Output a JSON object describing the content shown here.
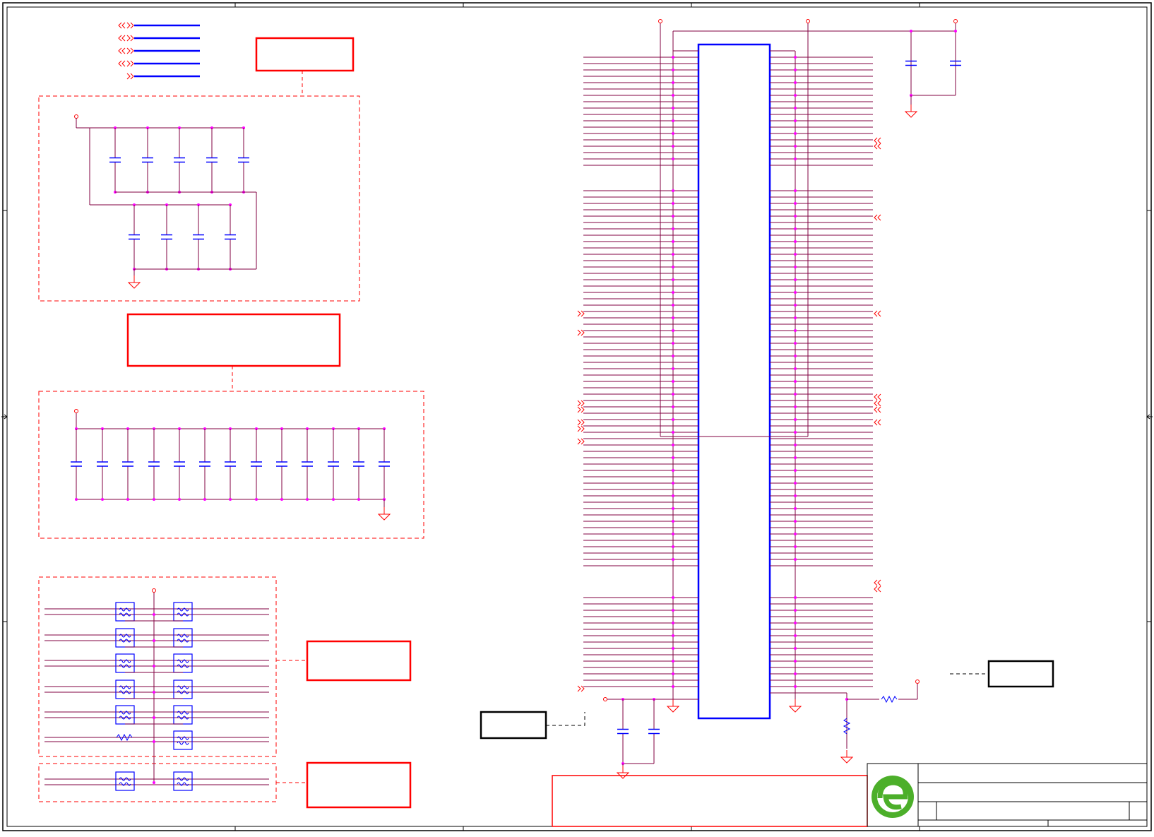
{
  "sheet": {
    "frame_color": "#000000",
    "net_color": "#800040",
    "bus_color": "#0000ff",
    "junction_color": "#ff00ff",
    "annotation_color": "#ff0000",
    "component_color": "#0000ff",
    "logo_color": "#4caf2a"
  },
  "title_block": {
    "logo": "company-logo-icon",
    "title": "",
    "sheet_label": "",
    "revision": ""
  },
  "notes": {
    "decoupling_group_1": "",
    "decoupling_group_2": "",
    "esd_group_1": "",
    "esd_group_2": "",
    "connector_note": "",
    "right_note": "",
    "bottom_note": ""
  }
}
